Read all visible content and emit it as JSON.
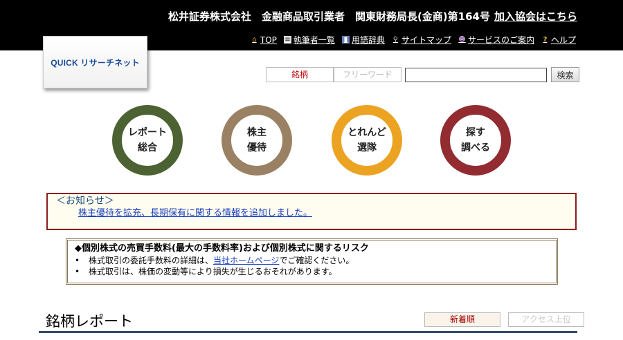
{
  "header": {
    "company_text": "松井証券株式会社　金融商品取引業者　関東財務局長(金商)第164号",
    "association_link": "加入協会はこちら",
    "nav": [
      {
        "label": "TOP",
        "icon": "home-icon"
      },
      {
        "label": "執筆者一覧",
        "icon": "document-icon"
      },
      {
        "label": "用語辞典",
        "icon": "book-icon"
      },
      {
        "label": "サイトマップ",
        "icon": "search-icon"
      },
      {
        "label": "サービスのご案内",
        "icon": "user-icon"
      },
      {
        "label": "ヘルプ",
        "icon": "help-icon"
      }
    ]
  },
  "logo": {
    "text": "QUICK リサーチネット"
  },
  "search": {
    "tab_active": "銘柄",
    "tab_inactive": "フリーワード",
    "input_value": "",
    "button": "検索"
  },
  "circles": [
    {
      "label": "レポート\n総合",
      "color": "#4c6233"
    },
    {
      "label": "株主\n優待",
      "color": "#9b8163"
    },
    {
      "label": "とれんど\n選隊",
      "color": "#eba321"
    },
    {
      "label": "探す\n調べる",
      "color": "#922c31"
    }
  ],
  "notice": {
    "title": "＜お知らせ＞",
    "link": "株主優待を拡充、長期保有に関する情報を追加しました。"
  },
  "risk": {
    "title": "◆個別株式の売買手数料(最大の手数料率)および個別株式に関するリスク",
    "item1_before": "株式取引の委託手数料の詳細は、",
    "item1_link": "当社ホームページ",
    "item1_after": "でご確認ください。",
    "item2": "株式取引は、株価の変動等により損失が生じるおそれがあります。",
    "bullet": "•"
  },
  "section": {
    "title": "銘柄レポート",
    "sort_active": "新着順",
    "sort_inactive": "アクセス上位"
  }
}
